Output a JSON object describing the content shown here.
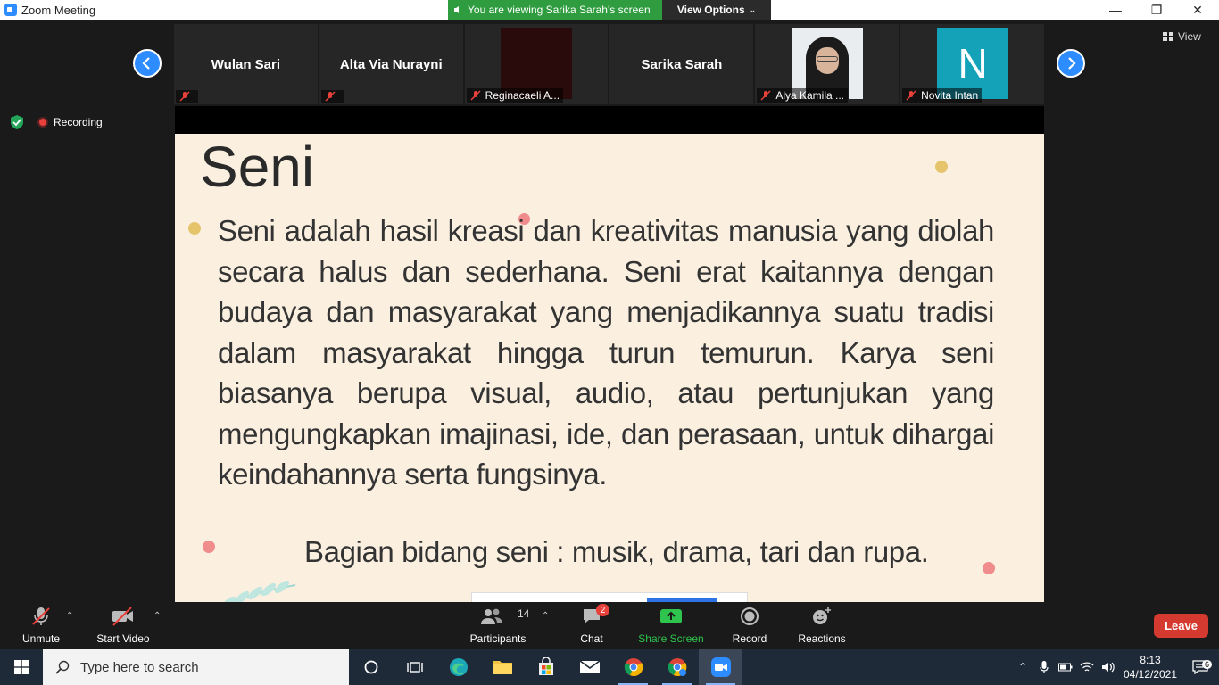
{
  "window": {
    "title": "Zoom Meeting"
  },
  "banner": {
    "viewing_text": "You are viewing Sarika Sarah's screen",
    "options_label": "View Options"
  },
  "top_right": {
    "view_label": "View"
  },
  "status": {
    "recording_label": "Recording"
  },
  "participants": [
    {
      "name": "Wulan Sari",
      "tag": ""
    },
    {
      "name": "Alta Via Nurayni",
      "tag": ""
    },
    {
      "name": "",
      "tag": "Reginacaeli A..."
    },
    {
      "name": "Sarika Sarah",
      "tag": ""
    },
    {
      "name": "",
      "tag": "Alya Kamila ..."
    },
    {
      "name": "",
      "tag": "Novita Intan",
      "avatar_letter": "N"
    }
  ],
  "slide": {
    "title": "Seni",
    "body": "Seni adalah hasil kreasi dan kreativitas manusia yang diolah secara halus dan sederhana. Seni erat kaitannya dengan budaya dan masyarakat yang menjadikannya suatu tradisi dalam masyarakat hingga turun temurun. Karya seni biasanya berupa visual, audio, atau pertunjukan yang mengungkapkan imajinasi, ide, dan perasaan, untuk dihargai keindahannya serta fungsinya.",
    "footer": "Bagian bidang seni : musik, drama, tari dan rupa."
  },
  "toolbar": {
    "unmute_label": "Unmute",
    "start_video_label": "Start Video",
    "participants_label": "Participants",
    "participants_count": "14",
    "chat_label": "Chat",
    "chat_badge": "2",
    "share_label": "Share Screen",
    "record_label": "Record",
    "reactions_label": "Reactions",
    "leave_label": "Leave"
  },
  "taskbar": {
    "search_placeholder": "Type here to search",
    "time": "8:13",
    "date": "04/12/2021",
    "notification_count": "6"
  },
  "colors": {
    "zoom_blue": "#2d8cff",
    "banner_green": "#2e9c3f",
    "leave_red": "#d43a2f",
    "slide_bg": "#fbf0e0"
  }
}
